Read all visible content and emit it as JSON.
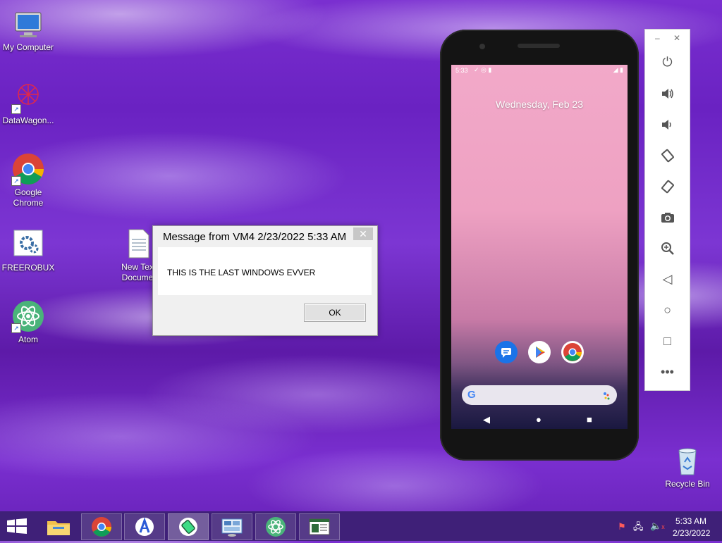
{
  "desktop": {
    "icons": [
      {
        "label": "My Computer",
        "icon": "computer-icon"
      },
      {
        "label": "DataWagon...",
        "icon": "datawagon-icon"
      },
      {
        "label": "Google Chrome",
        "icon": "chrome-icon"
      },
      {
        "label": "FREEROBUX",
        "icon": "settings-file-icon"
      },
      {
        "label": "Atom",
        "icon": "atom-icon"
      },
      {
        "label": "New Tex Docume",
        "icon": "text-document-icon"
      },
      {
        "label": "Recycle Bin",
        "icon": "recycle-bin-icon"
      }
    ]
  },
  "dialog": {
    "title": "Message from VM4 2/23/2022 5:33 AM",
    "close_label": "✕",
    "message": "THIS IS THE LAST WINDOWS EVVER",
    "ok_label": "OK"
  },
  "phone": {
    "status_time": "5:33",
    "date_text": "Wednesday, Feb 23",
    "apps": [
      "messages-icon",
      "play-store-icon",
      "chrome-icon"
    ],
    "search_icon": "google-icon",
    "nav": [
      "◀",
      "●",
      "■"
    ]
  },
  "emulator_toolbar": {
    "window_controls": [
      "–",
      "✕"
    ],
    "buttons": [
      "power-icon",
      "volume-up-icon",
      "volume-down-icon",
      "rotate-left-icon",
      "rotate-right-icon",
      "camera-icon",
      "zoom-icon",
      "back-icon",
      "home-icon",
      "overview-icon",
      "more-icon"
    ]
  },
  "taskbar": {
    "start_icon": "windows-start-icon",
    "items": [
      "file-explorer-icon",
      "chrome-icon",
      "app-icon",
      "emulator-icon",
      "remote-desktop-icon",
      "atom-icon",
      "document-viewer-icon"
    ],
    "clock_time": "5:33 AM",
    "clock_date": "2/23/2022"
  }
}
